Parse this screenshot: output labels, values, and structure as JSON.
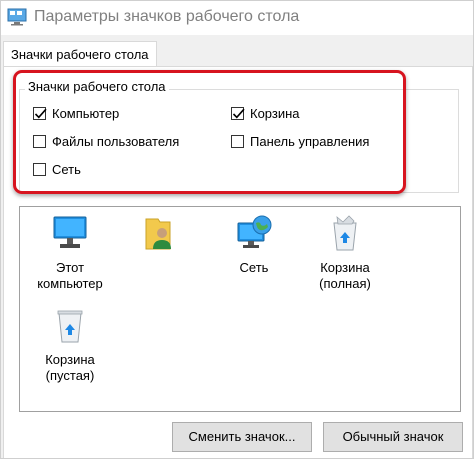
{
  "window": {
    "title": "Параметры значков рабочего стола"
  },
  "tabs": [
    {
      "label": "Значки рабочего стола",
      "active": true
    }
  ],
  "group": {
    "legend": "Значки рабочего стола",
    "checkboxes": [
      {
        "label": "Компьютер",
        "checked": true
      },
      {
        "label": "Корзина",
        "checked": true
      },
      {
        "label": "Файлы пользователя",
        "checked": false
      },
      {
        "label": "Панель управления",
        "checked": false
      },
      {
        "label": "Сеть",
        "checked": false
      }
    ]
  },
  "icons": [
    {
      "icon": "computer-icon",
      "line1": "Этот",
      "line2": "компьютер"
    },
    {
      "icon": "user-folder-icon",
      "line1": "",
      "line2": ""
    },
    {
      "icon": "network-icon",
      "line1": "Сеть",
      "line2": ""
    },
    {
      "icon": "recycle-bin-full-icon",
      "line1": "Корзина",
      "line2": "(полная)"
    },
    {
      "icon": "recycle-bin-empty-icon",
      "line1": "Корзина",
      "line2": "(пустая)"
    }
  ],
  "buttons": {
    "change_icon": "Сменить значок...",
    "default_icon": "Обычный значок"
  },
  "colors": {
    "highlight": "#d7141f",
    "checkbox_border": "#333333",
    "button_bg": "#e1e1e1"
  }
}
